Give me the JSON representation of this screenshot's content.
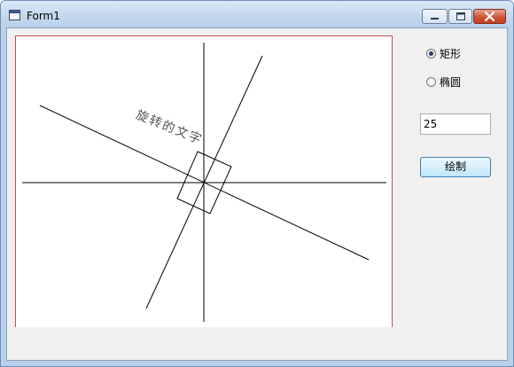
{
  "window": {
    "title": "Form1",
    "icon": "form-icon"
  },
  "titlebar_buttons": {
    "minimize": "minimize-icon",
    "maximize": "maximize-icon",
    "close": "close-icon"
  },
  "canvas": {
    "rotated_text": "旋转的文字",
    "rotation_degrees": 22
  },
  "options": [
    {
      "label": "矩形",
      "checked": true
    },
    {
      "label": "椭圆",
      "checked": false
    }
  ],
  "angle_input": {
    "value": "25"
  },
  "draw_button": {
    "label": "绘制"
  },
  "colors": {
    "canvas_border": "#c0504d",
    "button_border": "#3c7fb1",
    "close_button": "#c94f34"
  }
}
